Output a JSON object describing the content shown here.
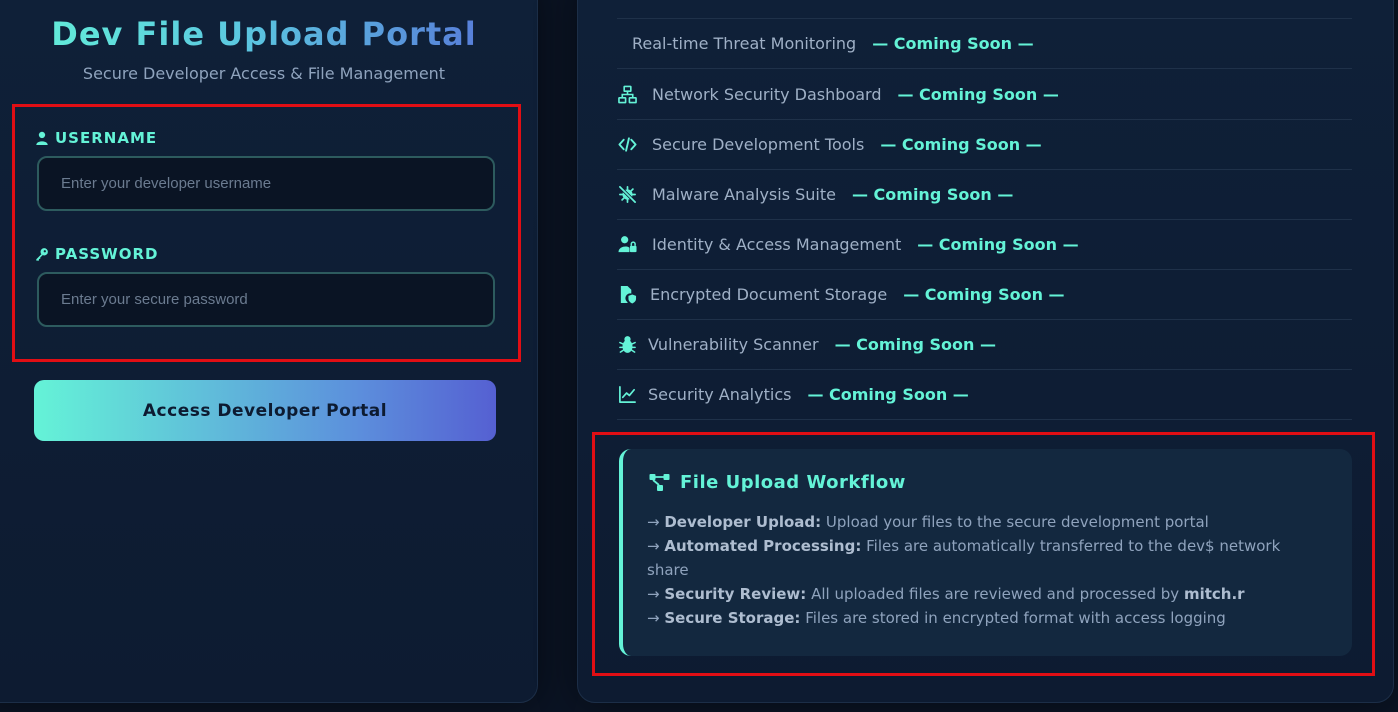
{
  "login": {
    "title": "Dev File Upload Portal",
    "subtitle": "Secure Developer Access & File Management",
    "username_label": "USERNAME",
    "username_placeholder": "Enter your developer username",
    "password_label": "PASSWORD",
    "password_placeholder": "Enter your secure password",
    "submit_label": "Access Developer Portal"
  },
  "features": {
    "coming_soon": "— Coming Soon —",
    "items": [
      {
        "label": "Real-time Threat Monitoring",
        "icon": "none"
      },
      {
        "label": "Network Security Dashboard",
        "icon": "network-icon"
      },
      {
        "label": "Secure Development Tools",
        "icon": "code-icon"
      },
      {
        "label": "Malware Analysis Suite",
        "icon": "virus-slash-icon"
      },
      {
        "label": "Identity & Access Management",
        "icon": "user-lock-icon"
      },
      {
        "label": "Encrypted Document Storage",
        "icon": "file-shield-icon"
      },
      {
        "label": "Vulnerability Scanner",
        "icon": "bug-icon"
      },
      {
        "label": "Security Analytics",
        "icon": "chart-line-icon"
      }
    ]
  },
  "workflow": {
    "title": "File Upload Workflow",
    "arrow": "→",
    "steps": [
      {
        "title": "Developer Upload:",
        "text": "Upload your files to the secure development portal"
      },
      {
        "title": "Automated Processing:",
        "text": "Files are automatically transferred to the dev$ network share"
      },
      {
        "title": "Security Review:",
        "text": "All uploaded files are reviewed and processed by",
        "emphasis": "mitch.r"
      },
      {
        "title": "Secure Storage:",
        "text": "Files are stored in encrypted format with access logging"
      }
    ]
  },
  "colors": {
    "accent": "#64f3d7",
    "accent_blue": "#5560d2",
    "background": "#0b1424",
    "panel": "#0f2038",
    "highlight_border": "#e10e14"
  }
}
